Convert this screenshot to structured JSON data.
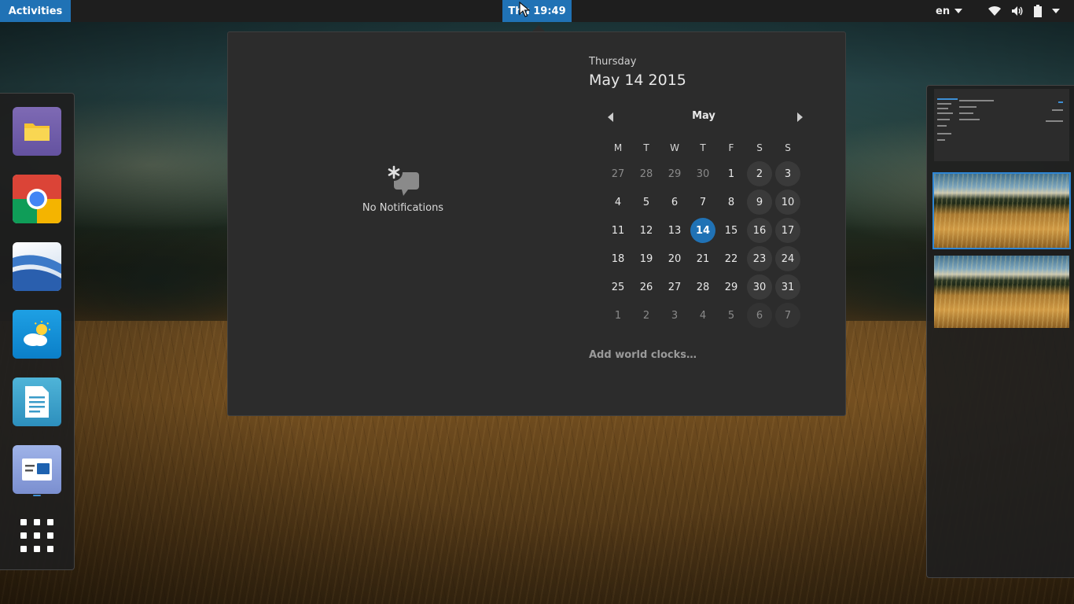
{
  "topbar": {
    "activities_label": "Activities",
    "clock_label": "Thu 19:49",
    "language_label": "en",
    "status_icons": [
      "wifi-icon",
      "volume-icon",
      "battery-icon",
      "system-menu-caret-icon"
    ]
  },
  "dock": {
    "apps": [
      {
        "name": "files",
        "icon": "folder-icon"
      },
      {
        "name": "chrome",
        "icon": "chrome-icon"
      },
      {
        "name": "google-earth",
        "icon": "earth-icon"
      },
      {
        "name": "weather",
        "icon": "weather-icon"
      },
      {
        "name": "documents",
        "icon": "document-icon"
      },
      {
        "name": "settings-app",
        "icon": "app-window-icon"
      }
    ],
    "show_apps_icon": "app-grid-icon"
  },
  "notifications": {
    "empty_label": "No Notifications",
    "icon": "notification-icon"
  },
  "calendar": {
    "weekday": "Thursday",
    "date": "May 14 2015",
    "month": "May",
    "day_headers": [
      "M",
      "T",
      "W",
      "T",
      "F",
      "S",
      "S"
    ],
    "weeks": [
      [
        "27",
        "28",
        "29",
        "30",
        "1",
        "2",
        "3"
      ],
      [
        "4",
        "5",
        "6",
        "7",
        "8",
        "9",
        "10"
      ],
      [
        "11",
        "12",
        "13",
        "14",
        "15",
        "16",
        "17"
      ],
      [
        "18",
        "19",
        "20",
        "21",
        "22",
        "23",
        "24"
      ],
      [
        "25",
        "26",
        "27",
        "28",
        "29",
        "30",
        "31"
      ],
      [
        "1",
        "2",
        "3",
        "4",
        "5",
        "6",
        "7"
      ]
    ],
    "today": "14",
    "add_world_clocks_label": "Add world clocks…"
  },
  "colors": {
    "accent": "#2072b5",
    "panel": "#2c2c2c",
    "topbar": "#1e1e1e"
  }
}
